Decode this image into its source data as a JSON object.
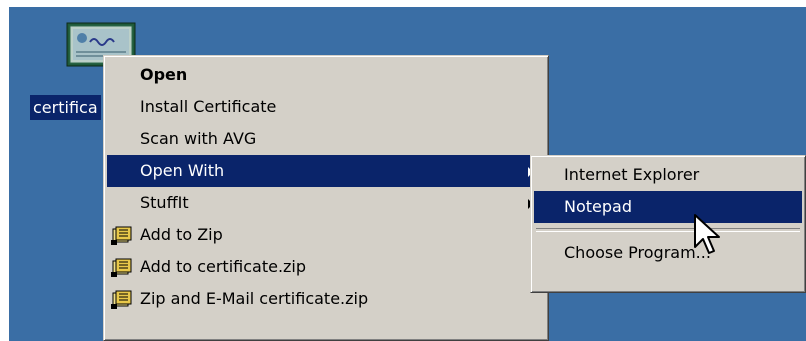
{
  "desktop": {
    "background": "#3a6ea5",
    "icon": {
      "name": "certificate-file-icon",
      "label": "certifica"
    }
  },
  "context_menu": {
    "items": [
      {
        "label": "Open",
        "bold": true
      },
      {
        "label": "Install Certificate"
      },
      {
        "label": "Scan with AVG"
      },
      {
        "label": "Open With",
        "highlighted": true,
        "submenu": true
      },
      {
        "label": "StuffIt",
        "submenu": true
      },
      {
        "label": "Add to Zip",
        "icon": "winzip-icon"
      },
      {
        "label": "Add to certificate.zip",
        "icon": "winzip-icon"
      },
      {
        "label": "Zip and E-Mail certificate.zip",
        "icon": "winzip-icon"
      }
    ]
  },
  "open_with_submenu": {
    "items": [
      {
        "label": "Internet Explorer"
      },
      {
        "label": "Notepad",
        "highlighted": true
      },
      {
        "label": "Choose Program..."
      }
    ]
  },
  "colors": {
    "menu_bg": "#d4d0c8",
    "highlight": "#0a246a",
    "highlight_text": "#ffffff"
  },
  "cursor": {
    "name": "arrow-cursor-icon"
  }
}
